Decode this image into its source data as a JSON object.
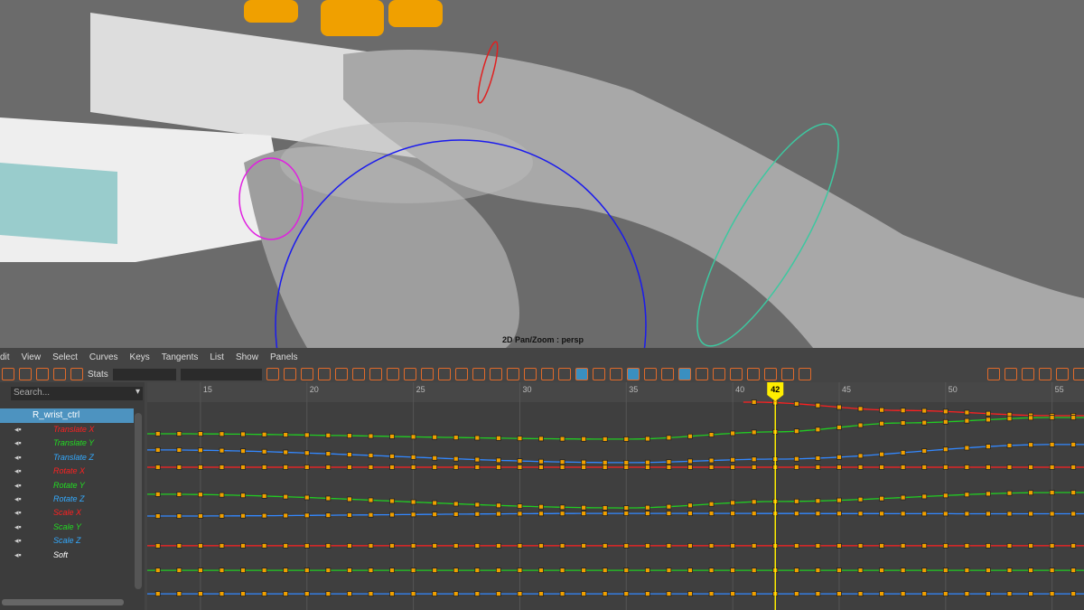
{
  "viewport": {
    "label": "2D Pan/Zoom : persp"
  },
  "menu": [
    "dit",
    "View",
    "Select",
    "Curves",
    "Keys",
    "Tangents",
    "List",
    "Show",
    "Panels"
  ],
  "toolbar": {
    "stats_label": "Stats"
  },
  "outliner": {
    "search_placeholder": "Search...",
    "node": "R_wrist_ctrl",
    "attributes": [
      {
        "name": "Translate X",
        "color": "#ff2020"
      },
      {
        "name": "Translate Y",
        "color": "#22dd22"
      },
      {
        "name": "Translate Z",
        "color": "#33aaff"
      },
      {
        "name": "Rotate X",
        "color": "#ff2020"
      },
      {
        "name": "Rotate Y",
        "color": "#22dd22"
      },
      {
        "name": "Rotate Z",
        "color": "#33aaff"
      },
      {
        "name": "Scale X",
        "color": "#ff2020"
      },
      {
        "name": "Scale Y",
        "color": "#22dd22"
      },
      {
        "name": "Scale Z",
        "color": "#33aaff"
      },
      {
        "name": "Soft",
        "color": "#ffffff"
      }
    ]
  },
  "timeline": {
    "ticks": [
      15,
      20,
      25,
      30,
      35,
      40,
      45,
      50,
      55
    ],
    "current_frame": "42",
    "current_color": "#ffee00",
    "key_color": "#f0a000"
  },
  "chart_data": {
    "type": "line",
    "xlim": [
      12.5,
      56.5
    ],
    "ylim": [
      0,
      100
    ],
    "series": [
      {
        "color": "#ff2020",
        "start": 41,
        "points": [
          [
            41,
            100
          ],
          [
            48,
            96
          ],
          [
            55,
            93.5
          ]
        ]
      },
      {
        "color": "#22cc22",
        "start": 13,
        "points": [
          [
            13,
            84.8
          ],
          [
            35,
            82.2
          ],
          [
            42,
            85.7
          ],
          [
            48,
            90
          ],
          [
            55,
            92.6
          ]
        ]
      },
      {
        "color": "#3388ff",
        "start": 13,
        "points": [
          [
            13,
            77
          ],
          [
            35,
            70.9
          ],
          [
            42,
            72.6
          ],
          [
            55,
            79.6
          ]
        ]
      },
      {
        "color": "#ff2020",
        "start": 13,
        "points": [
          [
            13,
            68.7
          ],
          [
            55,
            68.7
          ]
        ]
      },
      {
        "color": "#22cc22",
        "start": 13,
        "points": [
          [
            13,
            55.7
          ],
          [
            35,
            49.1
          ],
          [
            42,
            52.2
          ],
          [
            55,
            56.5
          ]
        ]
      },
      {
        "color": "#3388ff",
        "start": 13,
        "points": [
          [
            13,
            45.2
          ],
          [
            35,
            46.5
          ],
          [
            55,
            46.3
          ]
        ]
      },
      {
        "color": "#ff2020",
        "start": 13,
        "points": [
          [
            13,
            30.9
          ],
          [
            55,
            30.9
          ]
        ]
      },
      {
        "color": "#22cc22",
        "start": 13,
        "points": [
          [
            13,
            19.1
          ],
          [
            55,
            19.1
          ]
        ]
      },
      {
        "color": "#3388ff",
        "start": 13,
        "points": [
          [
            13,
            7.8
          ],
          [
            55,
            7.8
          ]
        ]
      }
    ]
  }
}
